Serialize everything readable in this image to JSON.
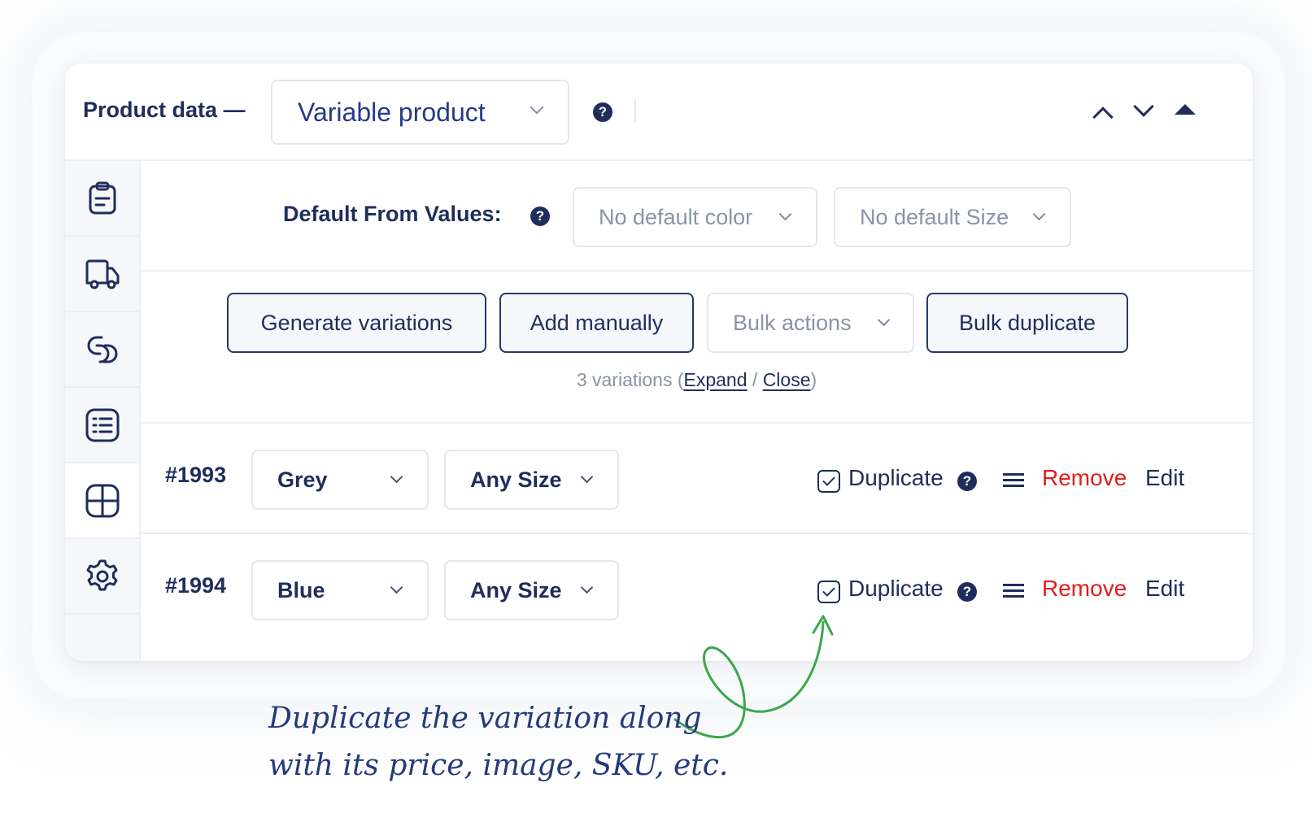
{
  "header": {
    "label": "Product data —",
    "product_type": "Variable product"
  },
  "defaults": {
    "label": "Default From Values:",
    "color_placeholder": "No default color",
    "size_placeholder": "No default Size"
  },
  "actions": {
    "generate": "Generate variations",
    "add_manually": "Add manually",
    "bulk_actions": "Bulk actions",
    "bulk_duplicate": "Bulk duplicate"
  },
  "variations_summary": {
    "count_text": "3 variations (",
    "expand": "Expand",
    "separator": " / ",
    "close": "Close",
    "end": ")"
  },
  "variations": [
    {
      "id": "#1993",
      "color": "Grey",
      "size": "Any Size",
      "duplicate": "Duplicate",
      "remove": "Remove",
      "edit": "Edit"
    },
    {
      "id": "#1994",
      "color": "Blue",
      "size": "Any Size",
      "duplicate": "Duplicate",
      "remove": "Remove",
      "edit": "Edit"
    }
  ],
  "sidebar": {
    "items": [
      {
        "icon": "clipboard-icon"
      },
      {
        "icon": "truck-icon"
      },
      {
        "icon": "link-icon"
      },
      {
        "icon": "list-icon"
      },
      {
        "icon": "grid-icon"
      },
      {
        "icon": "gear-icon"
      }
    ]
  },
  "help_glyph": "?",
  "annotation": {
    "line1": "Duplicate the variation along",
    "line2": "with its price, image, SKU, etc."
  },
  "colors": {
    "primary": "#1f2d5c",
    "remove": "#e51c1c",
    "annotation_arrow": "#3aa84a"
  }
}
